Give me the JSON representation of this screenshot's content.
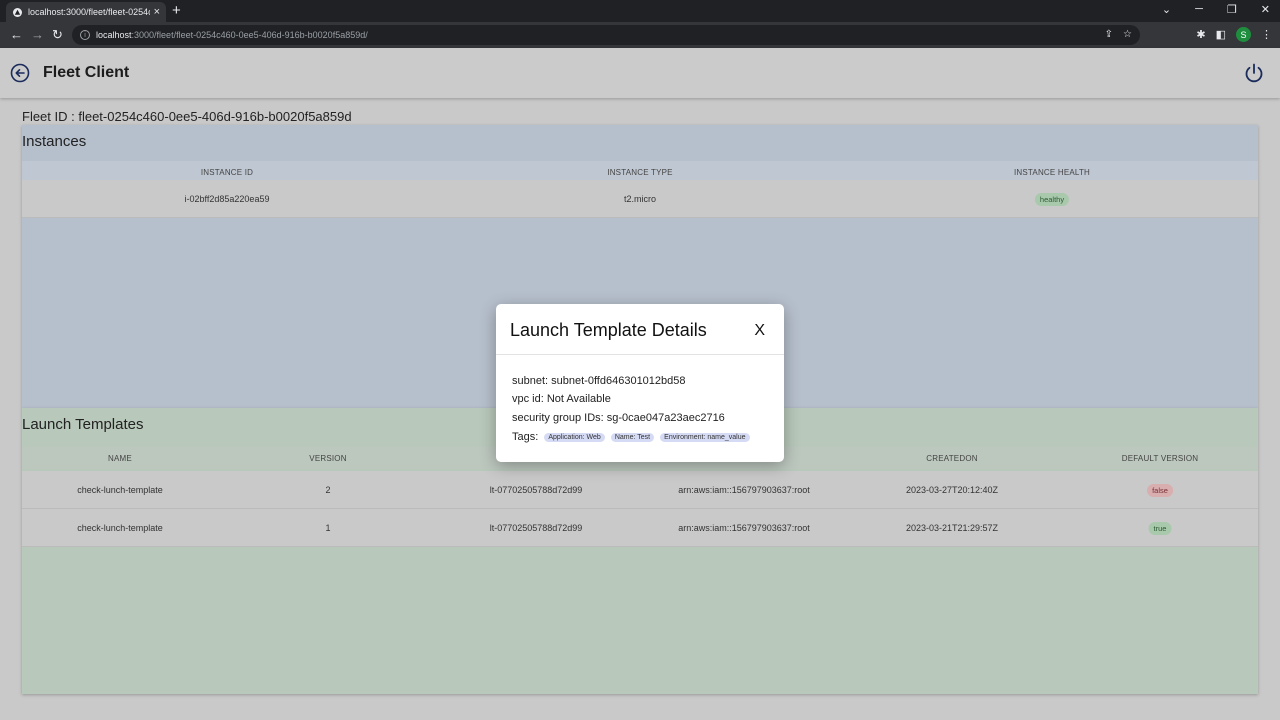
{
  "browser": {
    "tab_title": "localhost:3000/fleet/fleet-0254c4",
    "url_host": "localhost",
    "url_rest": ":3000/fleet/fleet-0254c460-0ee5-406d-916b-b0020f5a859d/",
    "profile_initial": "S"
  },
  "app": {
    "title": "Fleet Client"
  },
  "fleet": {
    "id_label": "Fleet ID : fleet-0254c460-0ee5-406d-916b-b0020f5a859d"
  },
  "instances": {
    "title": "Instances",
    "columns": [
      "INSTANCE ID",
      "INSTANCE TYPE",
      "INSTANCE HEALTH"
    ],
    "rows": [
      {
        "instance_id": "i-02bff2d85a220ea59",
        "instance_type": "t2.micro",
        "health": "healthy"
      }
    ]
  },
  "launch_templates": {
    "title": "Launch Templates",
    "columns": [
      "NAME",
      "VERSION",
      "",
      "",
      "CREATEDON",
      "DEFAULT VERSION"
    ],
    "rows": [
      {
        "name": "check-lunch-template",
        "version": "2",
        "template_id": "lt-07702505788d72d99",
        "created_by": "arn:aws:iam::156797903637:root",
        "created_on": "2023-03-27T20:12:40Z",
        "default": "false"
      },
      {
        "name": "check-lunch-template",
        "version": "1",
        "template_id": "lt-07702505788d72d99",
        "created_by": "arn:aws:iam::156797903637:root",
        "created_on": "2023-03-21T21:29:57Z",
        "default": "true"
      }
    ]
  },
  "modal": {
    "title": "Launch Template Details",
    "close_label": "X",
    "subnet": "subnet: subnet-0ffd646301012bd58",
    "vpc": "vpc id:  Not Available",
    "security_groups": "security group IDs: sg-0cae047a23aec2716",
    "tags_label": "Tags:",
    "tags": [
      "Application: Web",
      "Name: Test",
      "Environment: name_value"
    ]
  },
  "colors": {
    "instances_bg": "#b6bfcc",
    "templates_bg": "#b8c8ba",
    "healthy_badge": "#a9c9ac",
    "false_badge": "#d8aeaf"
  }
}
